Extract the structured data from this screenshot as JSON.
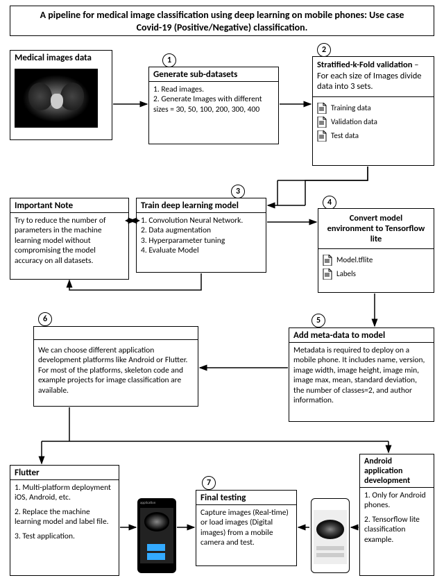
{
  "title": "A pipeline for medical image classification using deep learning on mobile phones: Use case Covid-19 (Positive/Negative) classification.",
  "medical": {
    "head": "Medical images data"
  },
  "step1": {
    "num": "1",
    "head": "Generate sub-datasets",
    "line1": "1. Read images.",
    "line2": "2. Generate Images with different sizes = 30, 50, 100, 200, 300, 400"
  },
  "step2": {
    "num": "2",
    "head_a": "Stratified-k-Fold validation",
    "head_b": " – For each size of Images divide data into 3 sets.",
    "f1": "Training data",
    "f2": "Validation data",
    "f3": "Test data"
  },
  "note": {
    "head": "Important Note",
    "body": "Try to reduce the number of parameters in the machine learning model without compromising the model accuracy on all datasets."
  },
  "step3": {
    "num": "3",
    "head": "Train deep learning model",
    "l1": "1. Convolution Neural Network.",
    "l2": "2. Data augmentation",
    "l3": "3. Hyperparameter tuning",
    "l4": "4. Evaluate Model"
  },
  "step4": {
    "num": "4",
    "head": "Convert model environment to Tensorflow lite",
    "f1": "Model.tflite",
    "f2": "Labels"
  },
  "step5": {
    "num": "5",
    "head": "Add meta-data to model",
    "body": "Metadata is required to deploy on a mobile phone. It includes name, version, image width, image height, image min, image max, mean, standard deviation, the number of classes=2, and author information."
  },
  "step6": {
    "num": "6",
    "body": "We can choose different application development platforms like Android or Flutter. For most of the platforms, skeleton code and example projects for image classification are available."
  },
  "flutter": {
    "head": "Flutter",
    "l1": "1. Multi-platform deployment iOS, Android, etc.",
    "l2": "2. Replace the machine learning model and label file.",
    "l3": "3. Test application."
  },
  "android": {
    "head": "Android application development",
    "l1": "1. Only for Android phones.",
    "l2": "2. Tensorflow lite classification example."
  },
  "step7": {
    "num": "7",
    "head": "Final testing",
    "body": "Capture images (Real-time) or load images (Digital images) from a mobile camera and test."
  },
  "icons": {
    "phone_label": "application"
  }
}
